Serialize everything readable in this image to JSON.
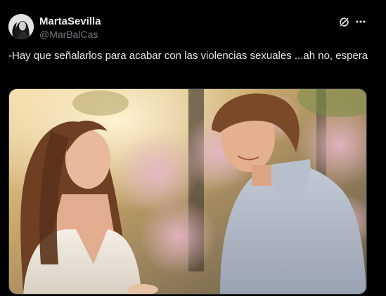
{
  "post": {
    "author": {
      "display_name": "MartaSevilla",
      "handle": "@MarBalCas"
    },
    "text": "-Hay que señalarlos para acabar con las violencias sexuales ...ah no, espera",
    "icons": {
      "grok": "grok-icon",
      "more": "more-horizontal-icon"
    },
    "colors": {
      "background": "#000000",
      "text": "#e7e9ea",
      "secondary": "#71767b"
    }
  }
}
